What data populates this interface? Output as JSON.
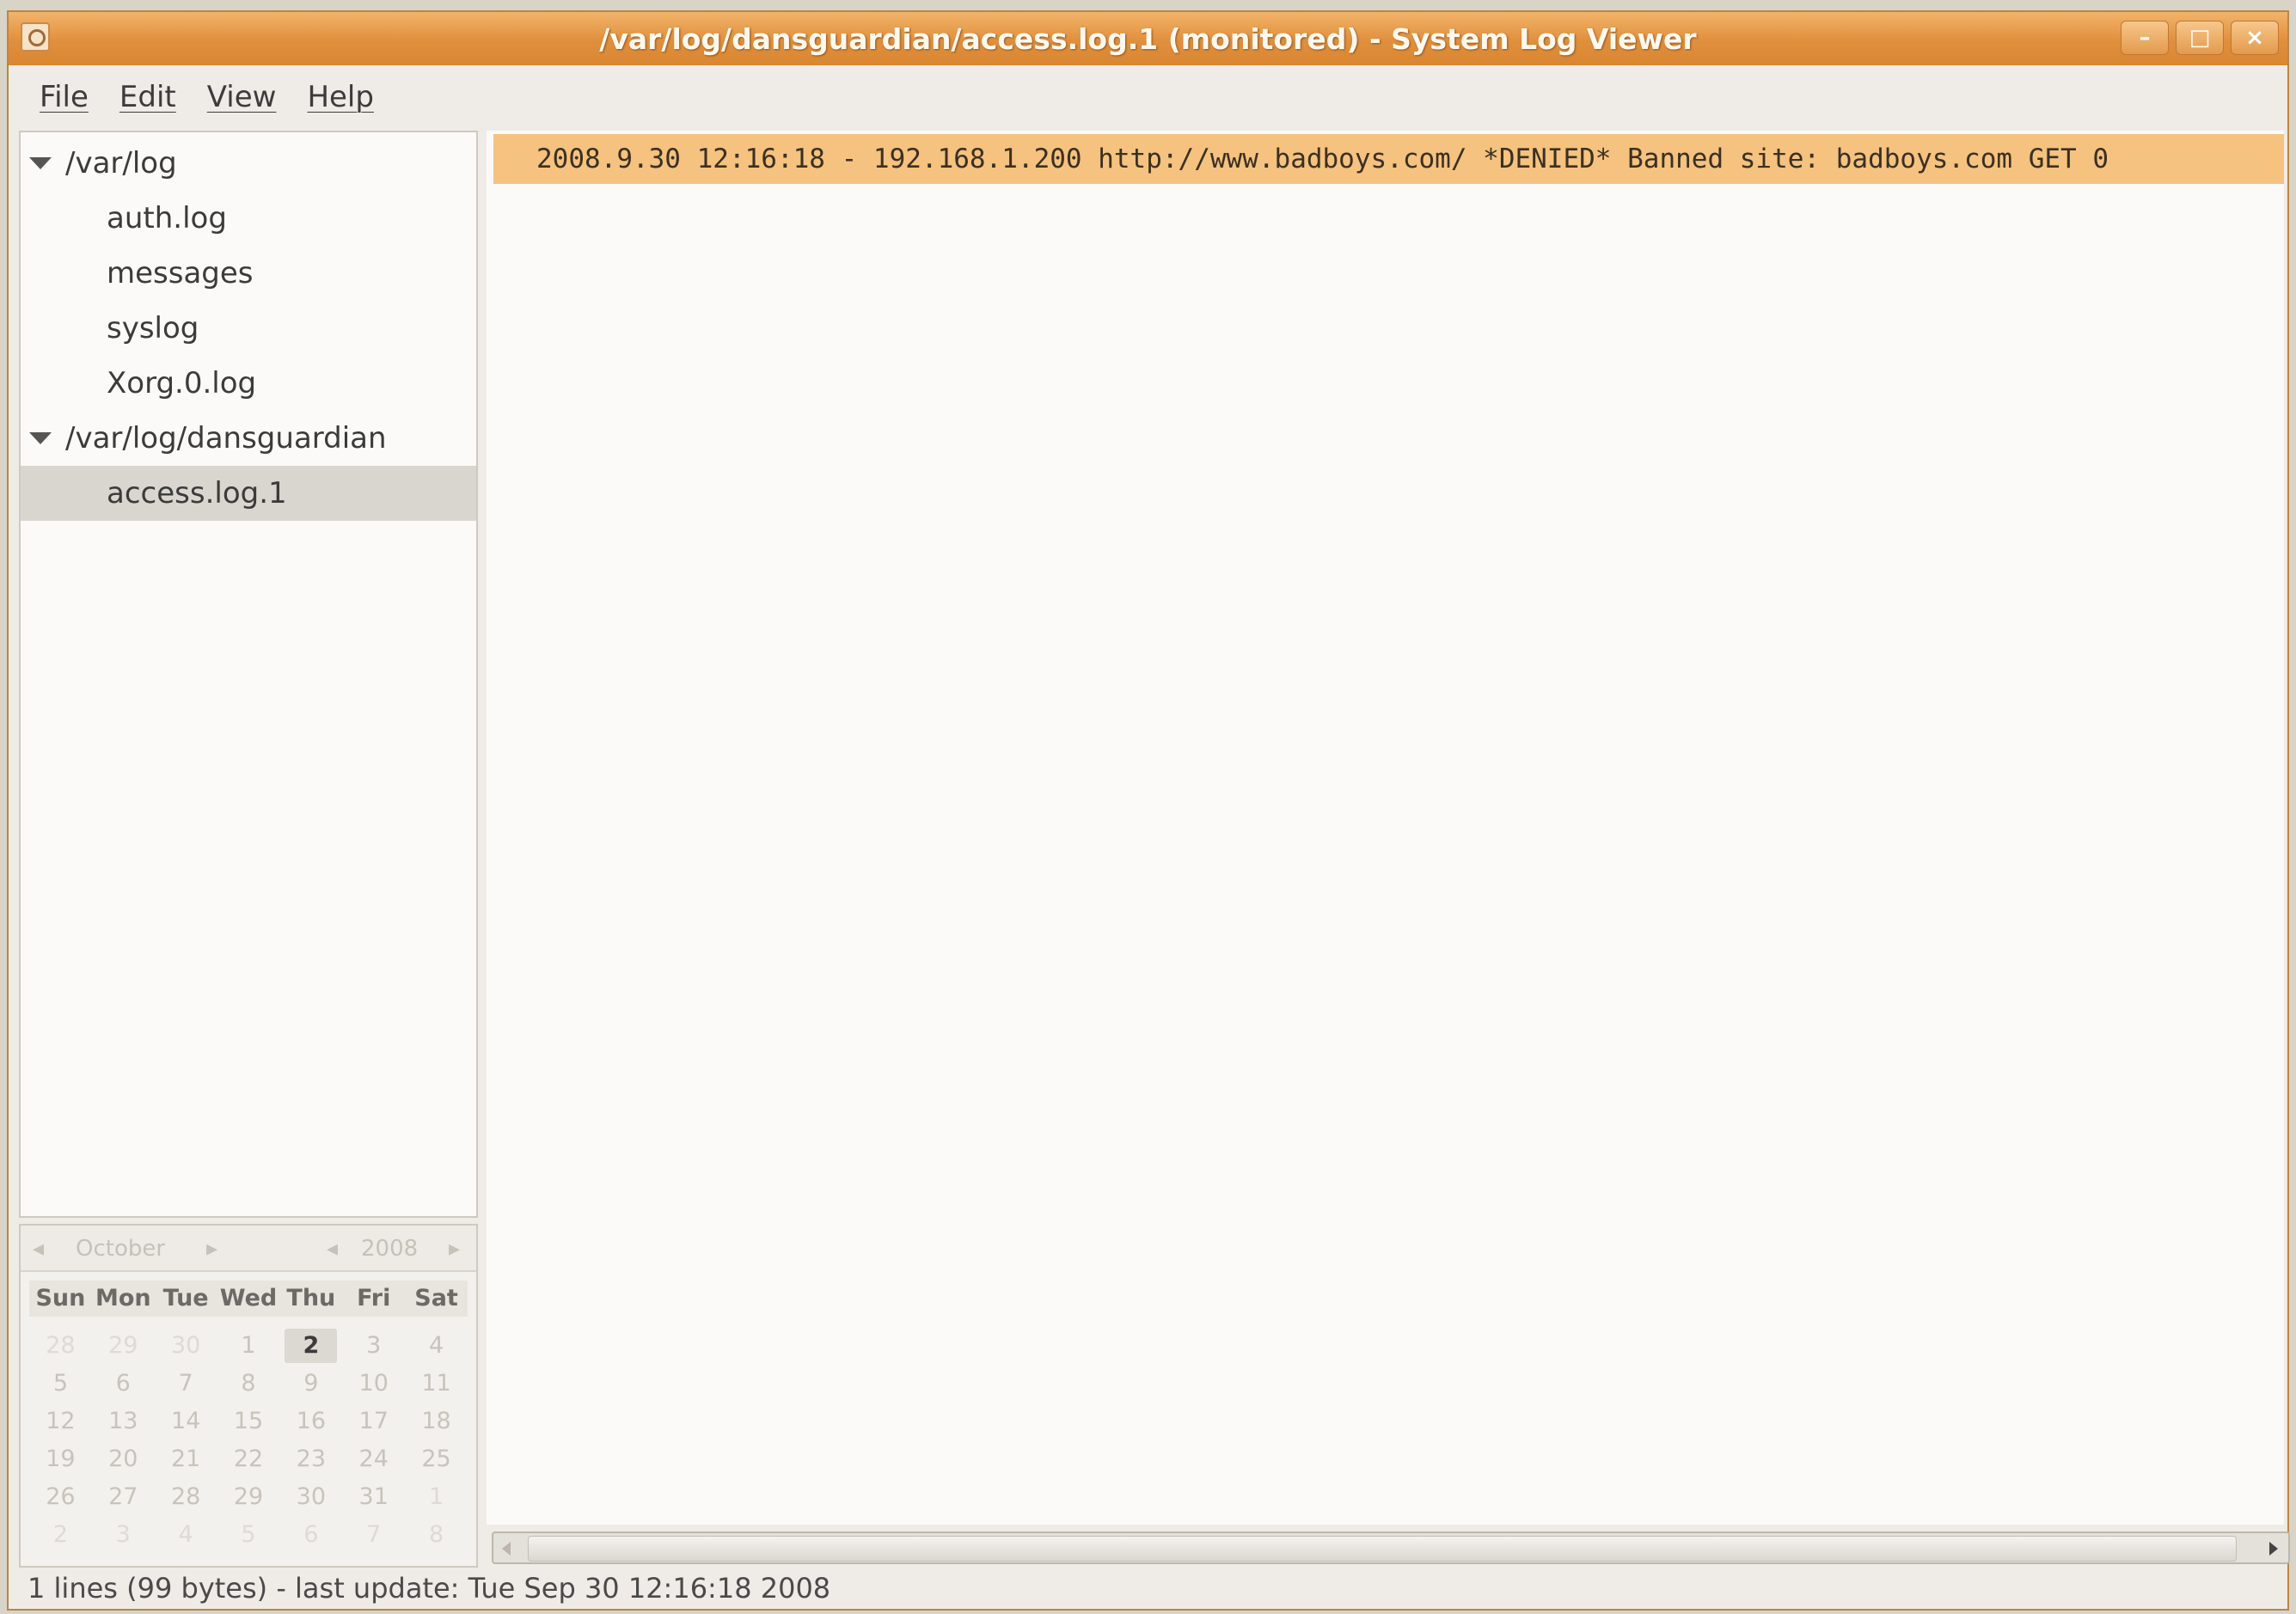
{
  "window": {
    "title": "/var/log/dansguardian/access.log.1 (monitored) - System Log Viewer",
    "buttons": {
      "minimize": "–",
      "maximize": "□",
      "close": "×"
    }
  },
  "menubar": {
    "items": [
      "File",
      "Edit",
      "View",
      "Help"
    ]
  },
  "tree": {
    "groups": [
      {
        "label": "/var/log",
        "children": [
          "auth.log",
          "messages",
          "syslog",
          "Xorg.0.log"
        ]
      },
      {
        "label": "/var/log/dansguardian",
        "children": [
          "access.log.1"
        ]
      }
    ],
    "selected": "access.log.1"
  },
  "calendar": {
    "month": "October",
    "year": "2008",
    "day_headers": [
      "Sun",
      "Mon",
      "Tue",
      "Wed",
      "Thu",
      "Fri",
      "Sat"
    ],
    "weeks": [
      [
        "28",
        "29",
        "30",
        "1",
        "2",
        "3",
        "4"
      ],
      [
        "5",
        "6",
        "7",
        "8",
        "9",
        "10",
        "11"
      ],
      [
        "12",
        "13",
        "14",
        "15",
        "16",
        "17",
        "18"
      ],
      [
        "19",
        "20",
        "21",
        "22",
        "23",
        "24",
        "25"
      ],
      [
        "26",
        "27",
        "28",
        "29",
        "30",
        "31",
        "1"
      ],
      [
        "2",
        "3",
        "4",
        "5",
        "6",
        "7",
        "8"
      ]
    ],
    "selected_day": "2"
  },
  "log": {
    "lines": [
      "2008.9.30 12:16:18 - 192.168.1.200 http://www.badboys.com/ *DENIED* Banned site: badboys.com GET 0"
    ]
  },
  "status": "1 lines (99 bytes) - last update: Tue Sep 30 12:16:18 2008",
  "colors": {
    "titlebar": "#e08f3c",
    "highlight": "#f5c27f"
  }
}
